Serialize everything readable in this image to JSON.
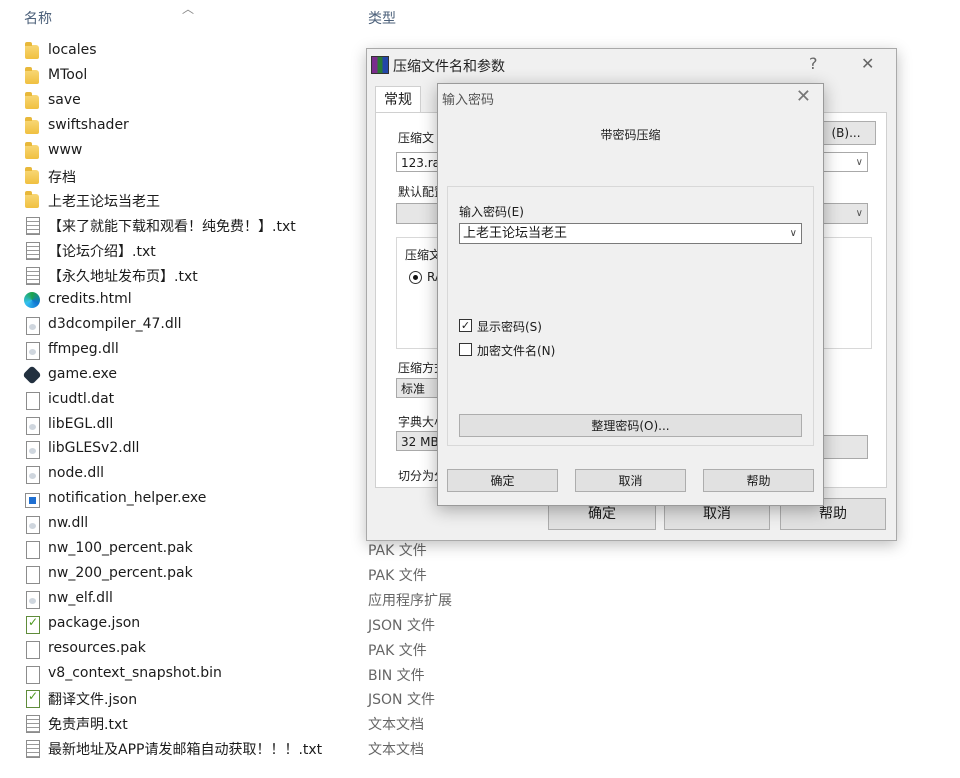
{
  "explorer": {
    "col_name": "名称",
    "col_type": "类型",
    "files": [
      {
        "name": "locales",
        "icon": "folder-icon",
        "type": ""
      },
      {
        "name": "MTool",
        "icon": "folder-icon",
        "type": ""
      },
      {
        "name": "save",
        "icon": "folder-icon",
        "type": ""
      },
      {
        "name": "swiftshader",
        "icon": "folder-icon",
        "type": ""
      },
      {
        "name": "www",
        "icon": "folder-icon",
        "type": ""
      },
      {
        "name": "存档",
        "icon": "folder-icon",
        "type": ""
      },
      {
        "name": "上老王论坛当老王",
        "icon": "folder-icon",
        "type": ""
      },
      {
        "name": "【来了就能下载和观看！纯免费！】.txt",
        "icon": "text-file-icon",
        "type": ""
      },
      {
        "name": "【论坛介绍】.txt",
        "icon": "text-file-icon",
        "type": ""
      },
      {
        "name": "【永久地址发布页】.txt",
        "icon": "text-file-icon",
        "type": ""
      },
      {
        "name": "credits.html",
        "icon": "edge-html-icon",
        "type": ""
      },
      {
        "name": "d3dcompiler_47.dll",
        "icon": "dll-file-icon",
        "type": ""
      },
      {
        "name": "ffmpeg.dll",
        "icon": "dll-file-icon",
        "type": ""
      },
      {
        "name": "game.exe",
        "icon": "game-exe-icon",
        "type": ""
      },
      {
        "name": "icudtl.dat",
        "icon": "blank-file-icon",
        "type": ""
      },
      {
        "name": "libEGL.dll",
        "icon": "dll-file-icon",
        "type": ""
      },
      {
        "name": "libGLESv2.dll",
        "icon": "dll-file-icon",
        "type": ""
      },
      {
        "name": "node.dll",
        "icon": "dll-file-icon",
        "type": ""
      },
      {
        "name": "notification_helper.exe",
        "icon": "exe-file-icon",
        "type": ""
      },
      {
        "name": "nw.dll",
        "icon": "dll-file-icon",
        "type": ""
      },
      {
        "name": "nw_100_percent.pak",
        "icon": "blank-file-icon",
        "type": "PAK 文件"
      },
      {
        "name": "nw_200_percent.pak",
        "icon": "blank-file-icon",
        "type": "PAK 文件"
      },
      {
        "name": "nw_elf.dll",
        "icon": "dll-file-icon",
        "type": "应用程序扩展"
      },
      {
        "name": "package.json",
        "icon": "json-file-icon",
        "type": "JSON 文件"
      },
      {
        "name": "resources.pak",
        "icon": "blank-file-icon",
        "type": "PAK 文件"
      },
      {
        "name": "v8_context_snapshot.bin",
        "icon": "blank-file-icon",
        "type": "BIN 文件"
      },
      {
        "name": "翻译文件.json",
        "icon": "json-file-icon",
        "type": "JSON 文件"
      },
      {
        "name": "免责声明.txt",
        "icon": "text-file-icon",
        "type": "文本文档"
      },
      {
        "name": "最新地址及APP请发邮箱自动获取！！！.txt",
        "icon": "text-file-icon",
        "type": "文本文档"
      }
    ]
  },
  "archive_dialog": {
    "title": "压缩文件名和参数",
    "help_glyph": "?",
    "close_glyph": "✕",
    "tab_general": "常规",
    "archive_name_label": "压缩文",
    "browse_button": "(B)...",
    "archive_name_value": "123.ra",
    "default_profile_label": "默认配置",
    "format_label": "压缩文",
    "format_option": "RA",
    "method_label": "压缩方式",
    "method_value": "标准",
    "dict_label": "字典大小",
    "dict_value": "32 MB",
    "split_label": "切分为分",
    "ok_button": "确定",
    "cancel_button": "取消",
    "help_button": "帮助"
  },
  "password_dialog": {
    "title": "输入密码",
    "close_glyph": "✕",
    "heading": "带密码压缩",
    "password_label": "输入密码(E)",
    "password_value": "上老王论坛当老王",
    "show_password_label": "显示密码(S)",
    "show_password_checked": true,
    "encrypt_names_label": "加密文件名(N)",
    "encrypt_names_checked": false,
    "organize_button": "整理密码(O)...",
    "ok_button": "确定",
    "cancel_button": "取消",
    "help_button": "帮助"
  }
}
